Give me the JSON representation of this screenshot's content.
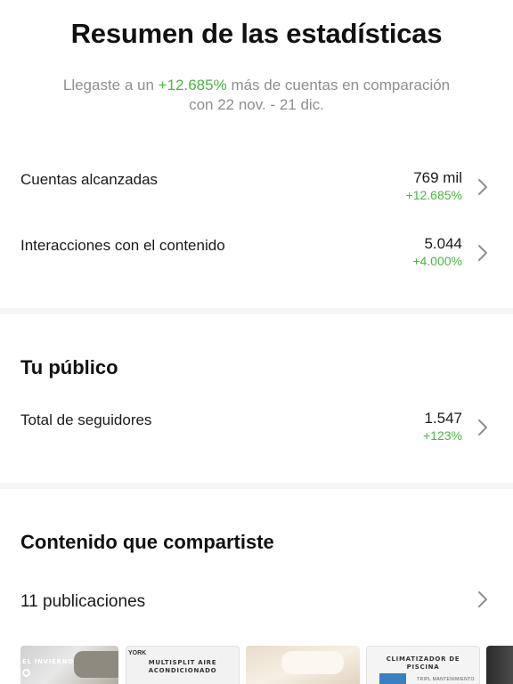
{
  "header": {
    "title": "Resumen de las estadísticas",
    "subtitle_pre": "Llegaste a un ",
    "subtitle_highlight": "+12.685%",
    "subtitle_post": " más de cuentas en comparación con 22 nov. - 21 dic."
  },
  "overview": [
    {
      "label": "Cuentas alcanzadas",
      "value": "769 mil",
      "change": "+12.685%"
    },
    {
      "label": "Interacciones con el contenido",
      "value": "5.044",
      "change": "+4.000%"
    }
  ],
  "audience": {
    "title": "Tu público",
    "row": {
      "label": "Total de seguidores",
      "value": "1.547",
      "change": "+123%"
    }
  },
  "content": {
    "title": "Contenido que compartiste",
    "posts_label": "11 publicaciones",
    "thumbnails": [
      {
        "text": "EL INVIERNO"
      },
      {
        "brand": "YORK",
        "text_line1": "MULTISPLIT AIRE",
        "text_line2": "ACONDICIONADO"
      },
      {
        "text": ""
      },
      {
        "text_line1": "CLIMATIZADOR DE",
        "text_line2": "PISCINA",
        "caption": "TRIPL MANTENIMIENTO"
      },
      {
        "text": ""
      }
    ]
  },
  "colors": {
    "positive": "#4bb543",
    "muted": "#8e8e93",
    "chevron": "#8e8e93"
  }
}
